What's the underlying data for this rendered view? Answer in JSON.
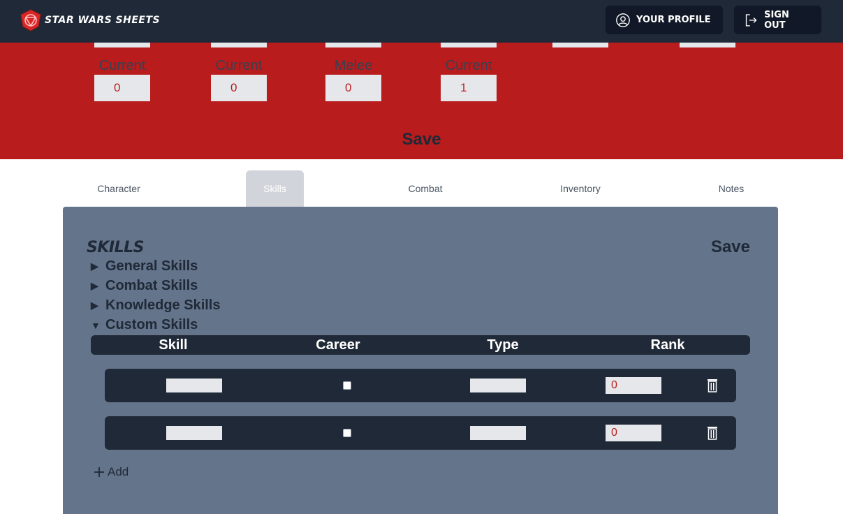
{
  "navbar": {
    "brand": "STAR WARS SHEETS",
    "profile_label": "YOUR PROFILE",
    "signout_label": "SIGN OUT"
  },
  "stats": [
    {
      "label": "Current",
      "value": "0"
    },
    {
      "label": "Current",
      "value": "0"
    },
    {
      "label": "Melee",
      "value": "0"
    },
    {
      "label": "Current",
      "value": "1"
    }
  ],
  "red_save_label": "Save",
  "tabs": [
    {
      "label": "Character"
    },
    {
      "label": "Skills",
      "active": true
    },
    {
      "label": "Combat"
    },
    {
      "label": "Inventory"
    },
    {
      "label": "Notes"
    }
  ],
  "panel": {
    "title": "SKILLS",
    "save_label": "Save",
    "sections": [
      {
        "label": "General Skills",
        "caret": "▶"
      },
      {
        "label": "Combat Skills",
        "caret": "▶"
      },
      {
        "label": "Knowledge Skills",
        "caret": "▶"
      },
      {
        "label": "Custom Skills",
        "caret": "▼"
      }
    ],
    "table": {
      "headers": [
        "Skill",
        "Career",
        "Type",
        "Rank"
      ],
      "rows": [
        {
          "skill": "",
          "career": false,
          "type": "",
          "rank": "0"
        },
        {
          "skill": "",
          "career": false,
          "type": "",
          "rank": "0"
        }
      ]
    },
    "add_label": "Add"
  }
}
